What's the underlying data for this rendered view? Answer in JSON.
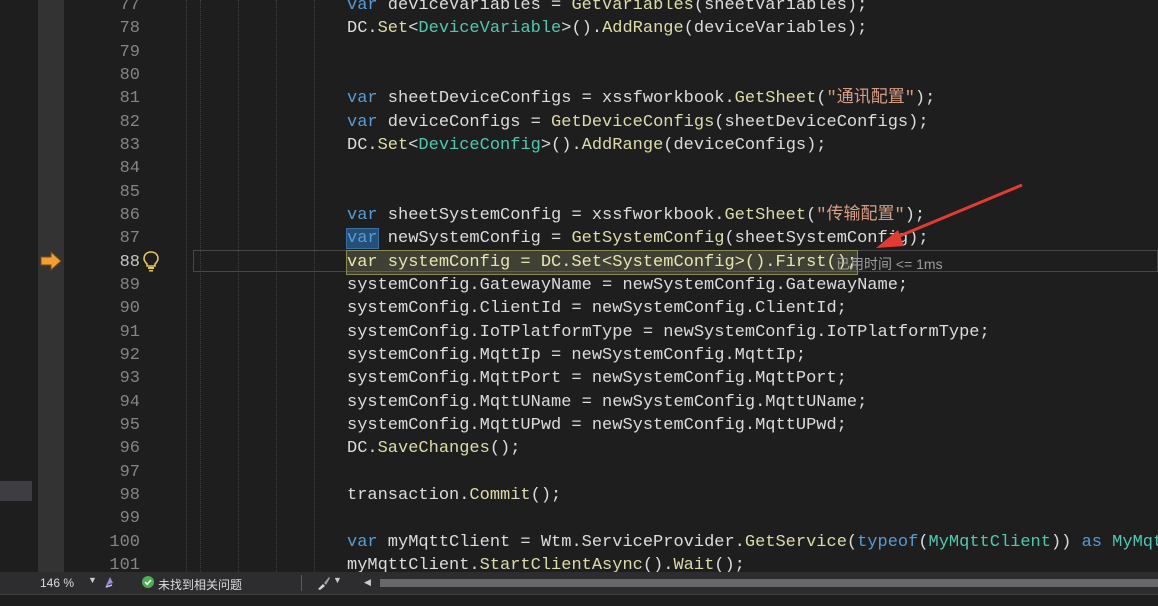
{
  "editor": {
    "line_numbers": [
      "77",
      "78",
      "79",
      "80",
      "81",
      "82",
      "83",
      "84",
      "85",
      "86",
      "87",
      "88",
      "89",
      "90",
      "91",
      "92",
      "93",
      "94",
      "95",
      "96",
      "97",
      "98",
      "99",
      "100",
      "101"
    ],
    "current_line": "88",
    "elapsed_hint": "已用时间 <= 1ms",
    "code": {
      "l77": "var deviceVariables = GetVariables(sheetVariables);",
      "l78": "DC.Set<DeviceVariable>().AddRange(deviceVariables);",
      "l81_kw": "var",
      "l81_a": " sheetDeviceConfigs = xssfworkbook.",
      "l81_m": "GetSheet",
      "l81_s": "\"通讯配置\"",
      "l82_kw": "var",
      "l82_a": " deviceConfigs = ",
      "l82_m": "GetDeviceConfigs",
      "l82_b": "(sheetDeviceConfigs);",
      "l83_a": "DC.",
      "l83_m": "Set",
      "l83_t": "DeviceConfig",
      "l83_m2": "AddRange",
      "l83_b": "(deviceConfigs);",
      "l86_kw": "var",
      "l86_a": " sheetSystemConfig = xssfworkbook.",
      "l86_m": "GetSheet",
      "l86_s": "\"传输配置\"",
      "l87_kw": "var",
      "l87_a": " newSystemConfig = ",
      "l87_m": "GetSystemConfig",
      "l87_b": "(sheetSystemConfig);",
      "l88": "var systemConfig = DC.Set<SystemConfig>().First();",
      "l89": "systemConfig.GatewayName = newSystemConfig.GatewayName;",
      "l90": "systemConfig.ClientId = newSystemConfig.ClientId;",
      "l91": "systemConfig.IoTPlatformType = newSystemConfig.IoTPlatformType;",
      "l92": "systemConfig.MqttIp = newSystemConfig.MqttIp;",
      "l93": "systemConfig.MqttPort = newSystemConfig.MqttPort;",
      "l94": "systemConfig.MqttUName = newSystemConfig.MqttUName;",
      "l95": "systemConfig.MqttUPwd = newSystemConfig.MqttUPwd;",
      "l96_a": "DC.",
      "l96_m": "SaveChanges",
      "l96_b": "();",
      "l98_a": "transaction.",
      "l98_m": "Commit",
      "l98_b": "();",
      "l100_kw": "var",
      "l100_a": " myMqttClient = Wtm.ServiceProvider.",
      "l100_m": "GetService",
      "l100_kw2": "typeof",
      "l100_t": "MyMqttClient",
      "l100_kw3": "as",
      "l100_t2": "MyMqttClier",
      "l101_a": "myMqttClient.",
      "l101_m": "StartClientAsync",
      "l101_m2": "Wait",
      "l101_b": "();"
    }
  },
  "statusbar": {
    "zoom": "146 %",
    "issues": "未找到相关问题"
  },
  "icons": {
    "current_statement": "arrow-right-icon",
    "quick_actions": "lightbulb-icon",
    "no_issues": "check-circle-icon",
    "cleanup": "brush-icon"
  },
  "colors": {
    "keyword": "#569cd6",
    "type": "#4ec9b0",
    "method": "#dcdcaa",
    "string": "#d69d85",
    "annotation_arrow": "#e03c31",
    "breakpoint_arrow": "#f0a030"
  }
}
